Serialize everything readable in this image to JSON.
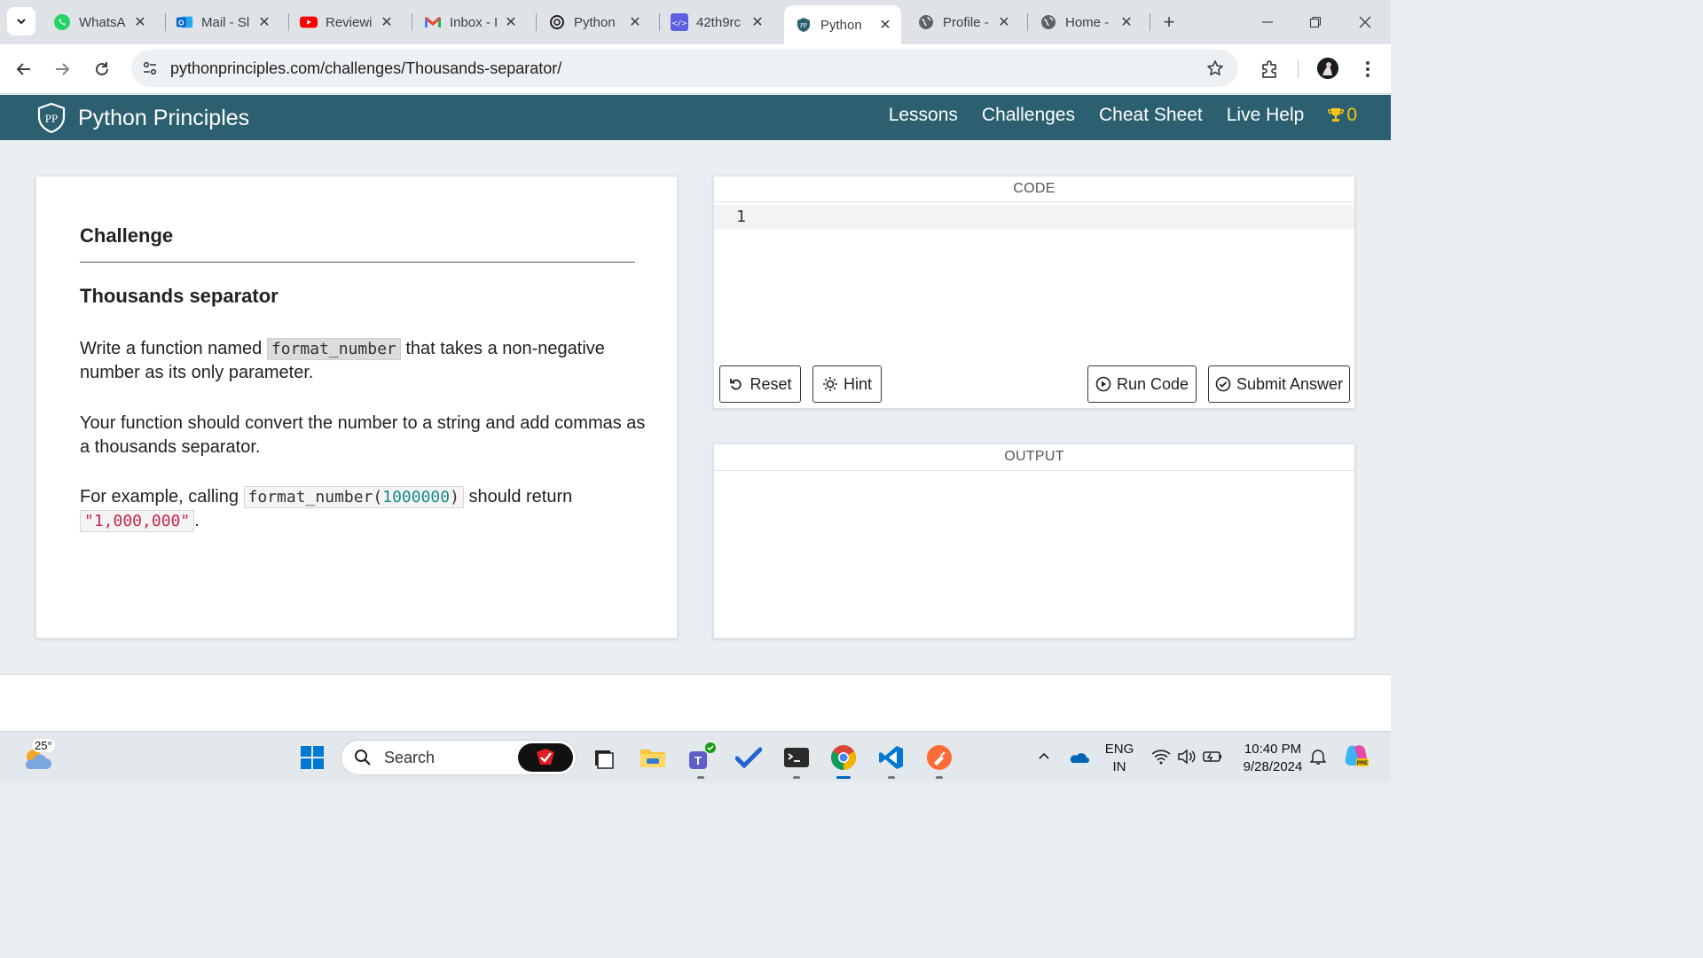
{
  "browser": {
    "tabs": [
      {
        "title": "WhatsA",
        "favicon": "whatsapp-icon",
        "color": "#25d366"
      },
      {
        "title": "Mail - Sl",
        "favicon": "outlook-icon",
        "color": "#0a64c8"
      },
      {
        "title": "Reviewi",
        "favicon": "youtube-icon",
        "color": "#ff0000"
      },
      {
        "title": "Inbox - I",
        "favicon": "gmail-icon",
        "color": "#ea4335"
      },
      {
        "title": "Python",
        "favicon": "openai-icon",
        "color": "#222222"
      },
      {
        "title": "42th9rc",
        "favicon": "code-icon",
        "color": "#5b5fe0"
      },
      {
        "title": "Python",
        "favicon": "python-principles-icon",
        "color": "#2c5f6f",
        "active": true
      },
      {
        "title": "Profile -",
        "favicon": "globe-icon",
        "color": "#5f6368"
      },
      {
        "title": "Home -",
        "favicon": "globe-icon",
        "color": "#5f6368"
      }
    ],
    "url": "pythonprinciples.com/challenges/Thousands-separator/"
  },
  "site": {
    "brand": "Python Principles",
    "nav": {
      "lessons": "Lessons",
      "challenges": "Challenges",
      "cheat_sheet": "Cheat Sheet",
      "live_help": "Live Help",
      "trophy_count": "0"
    },
    "accent": "#2c5f6f",
    "trophy_color": "#f3c514"
  },
  "challenge": {
    "heading": "Challenge",
    "title": "Thousands separator",
    "p1_before": "Write a function named",
    "p1_code": "format_number",
    "p1_after": "that takes a non-negative number as its only parameter.",
    "p2": "Your function should convert the number to a string and add commas as a thousands separator.",
    "p3_before": "For example, calling",
    "p3_code_fn": "format_number(",
    "p3_code_num": "1000000",
    "p3_code_close": ")",
    "p3_middle": "should return",
    "p3_result": "\"1,000,000\"",
    "p3_end": "."
  },
  "editor": {
    "label": "CODE",
    "line_number": "1",
    "buttons": {
      "reset": "Reset",
      "hint": "Hint",
      "run": "Run Code",
      "submit": "Submit Answer"
    }
  },
  "output": {
    "label": "OUTPUT"
  },
  "taskbar": {
    "temperature": "25°",
    "search_label": "Search",
    "language_top": "ENG",
    "language_bottom": "IN",
    "time": "10:40 PM",
    "date": "9/28/2024"
  }
}
